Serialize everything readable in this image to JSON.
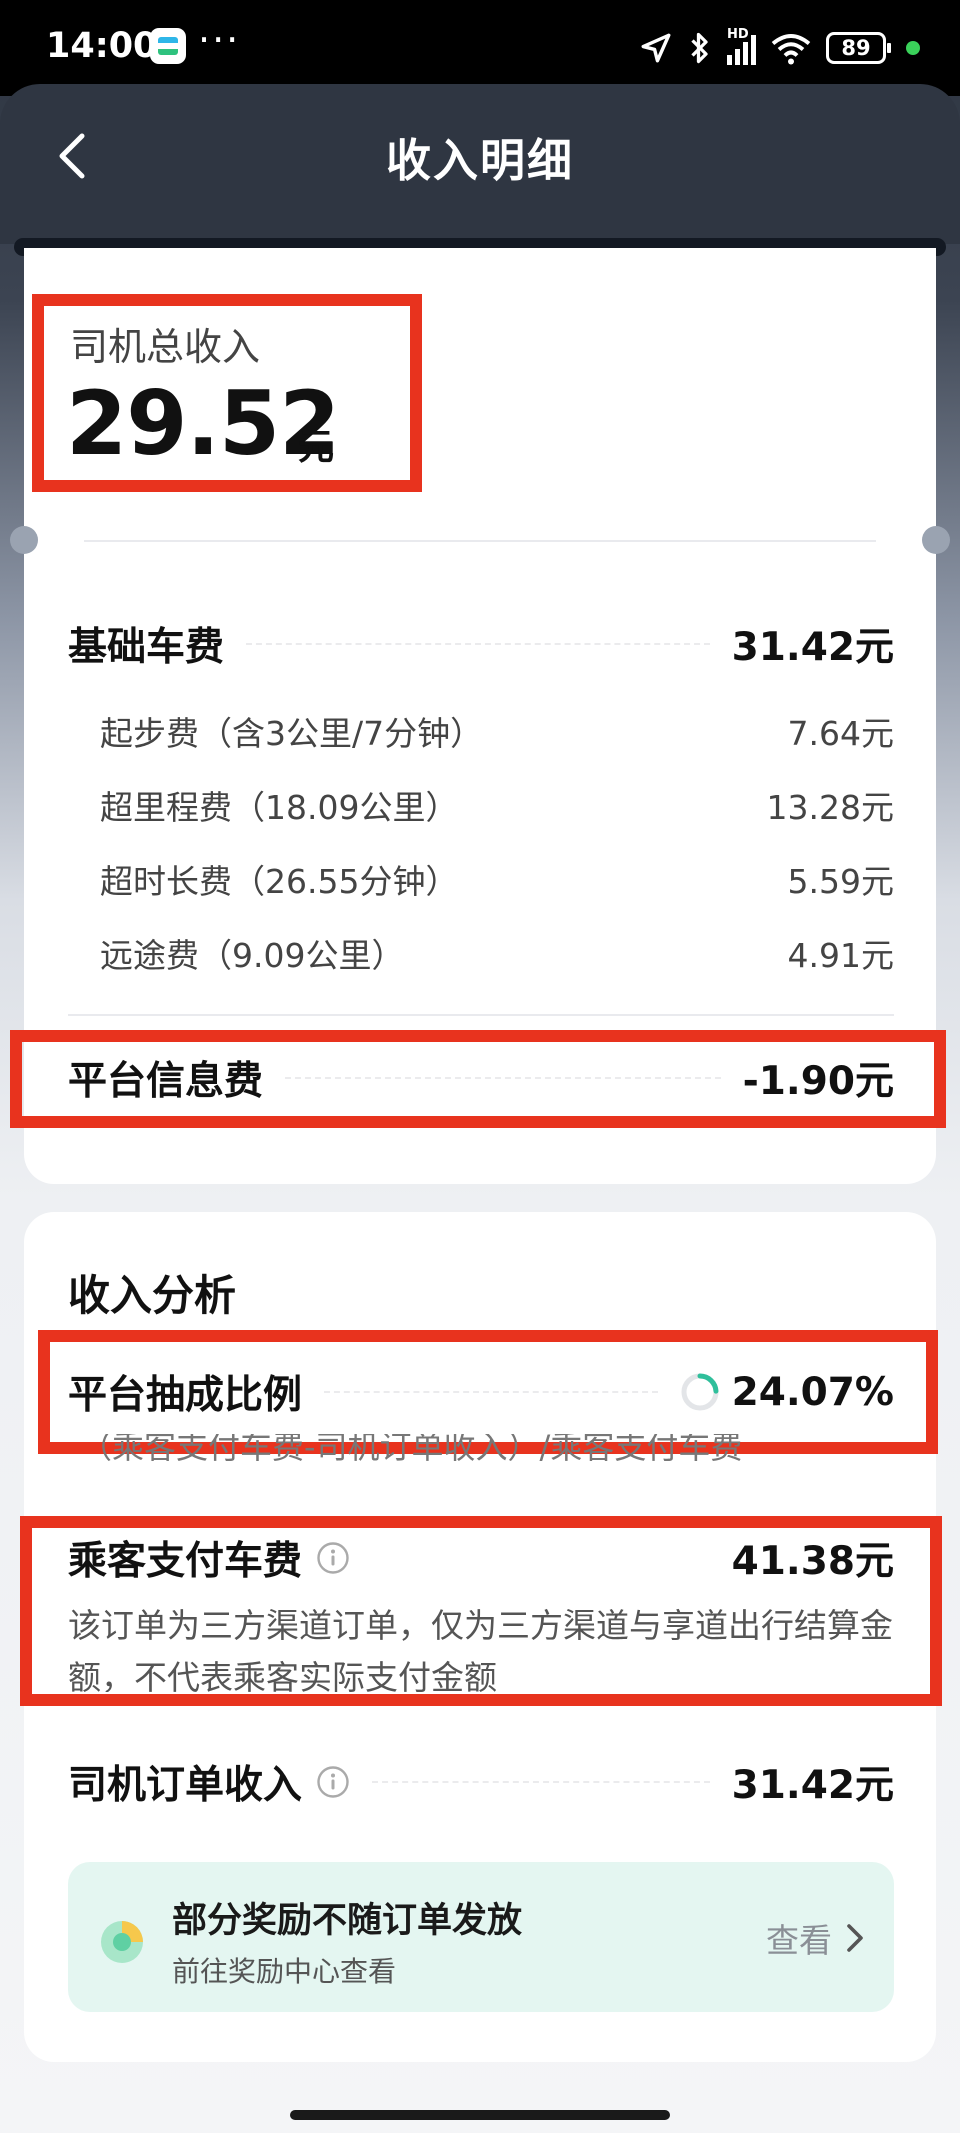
{
  "status_bar": {
    "time": "14:00",
    "dots": "···",
    "network": "HD",
    "battery": "89"
  },
  "header": {
    "title": "收入明细"
  },
  "total": {
    "label": "司机总收入",
    "amount": "29.52",
    "unit": "元"
  },
  "base_fare": {
    "label": "基础车费",
    "value": "31.42元",
    "items": [
      {
        "label": "起步费（含3公里/7分钟）",
        "value": "7.64元"
      },
      {
        "label": "超里程费（18.09公里）",
        "value": "13.28元"
      },
      {
        "label": "超时长费（26.55分钟）",
        "value": "5.59元"
      },
      {
        "label": "远途费（9.09公里）",
        "value": "4.91元"
      }
    ]
  },
  "platform_fee": {
    "label": "平台信息费",
    "value": "-1.90元"
  },
  "analysis": {
    "title": "收入分析",
    "commission": {
      "label": "平台抽成比例",
      "value": "24.07%",
      "ratio": 0.2407,
      "formula": "（乘客支付车费-司机订单收入）/乘客支付车费"
    },
    "passenger_fare": {
      "label": "乘客支付车费",
      "value": "41.38元",
      "note": "该订单为三方渠道订单，仅为三方渠道与享道出行结算金额，不代表乘客实际支付金额"
    },
    "driver_income": {
      "label": "司机订单收入",
      "value": "31.42元"
    }
  },
  "reward": {
    "title": "部分奖励不随订单发放",
    "subtitle": "前往奖励中心查看",
    "link": "查看"
  },
  "colors": {
    "highlight": "#e8331e",
    "accent": "#2fbf9b",
    "header_bg": "#2f3642",
    "reward_bg": "#e4f6f1"
  }
}
